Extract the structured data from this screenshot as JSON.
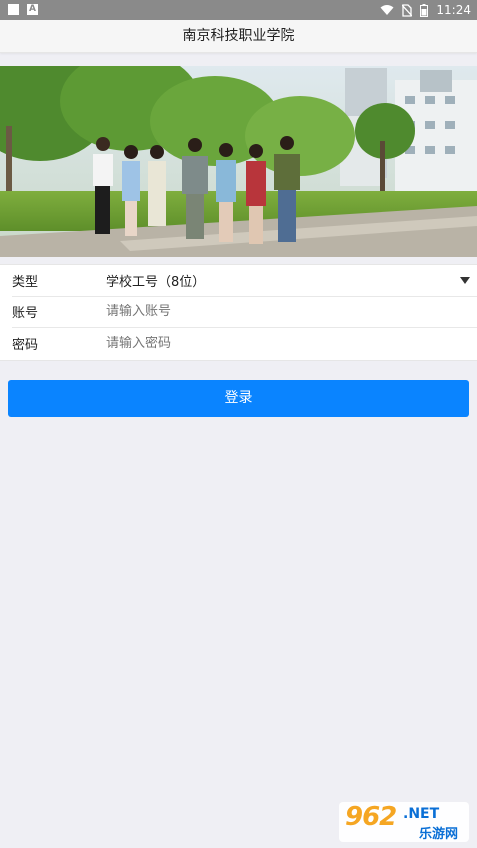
{
  "status_bar": {
    "time": "11:24",
    "left_icons": [
      "square-icon",
      "a-badge-icon"
    ],
    "right_icons": [
      "wifi-icon",
      "no-sim-icon",
      "battery-icon"
    ]
  },
  "header": {
    "title": "南京科技职业学院"
  },
  "banner": {
    "image": "campus-students-photo"
  },
  "form": {
    "type_label": "类型",
    "type_value": "学校工号（8位）",
    "account_label": "账号",
    "account_placeholder": "请输入账号",
    "account_value": "",
    "password_label": "密码",
    "password_placeholder": "请输入密码",
    "password_value": ""
  },
  "login_button": {
    "label": "登录"
  },
  "watermark": {
    "number": "962",
    "dot_net": ".NET",
    "name": "乐游网"
  },
  "colors": {
    "accent": "#0a84ff",
    "background": "#efeff4",
    "status_bar": "#8a8a8a"
  }
}
